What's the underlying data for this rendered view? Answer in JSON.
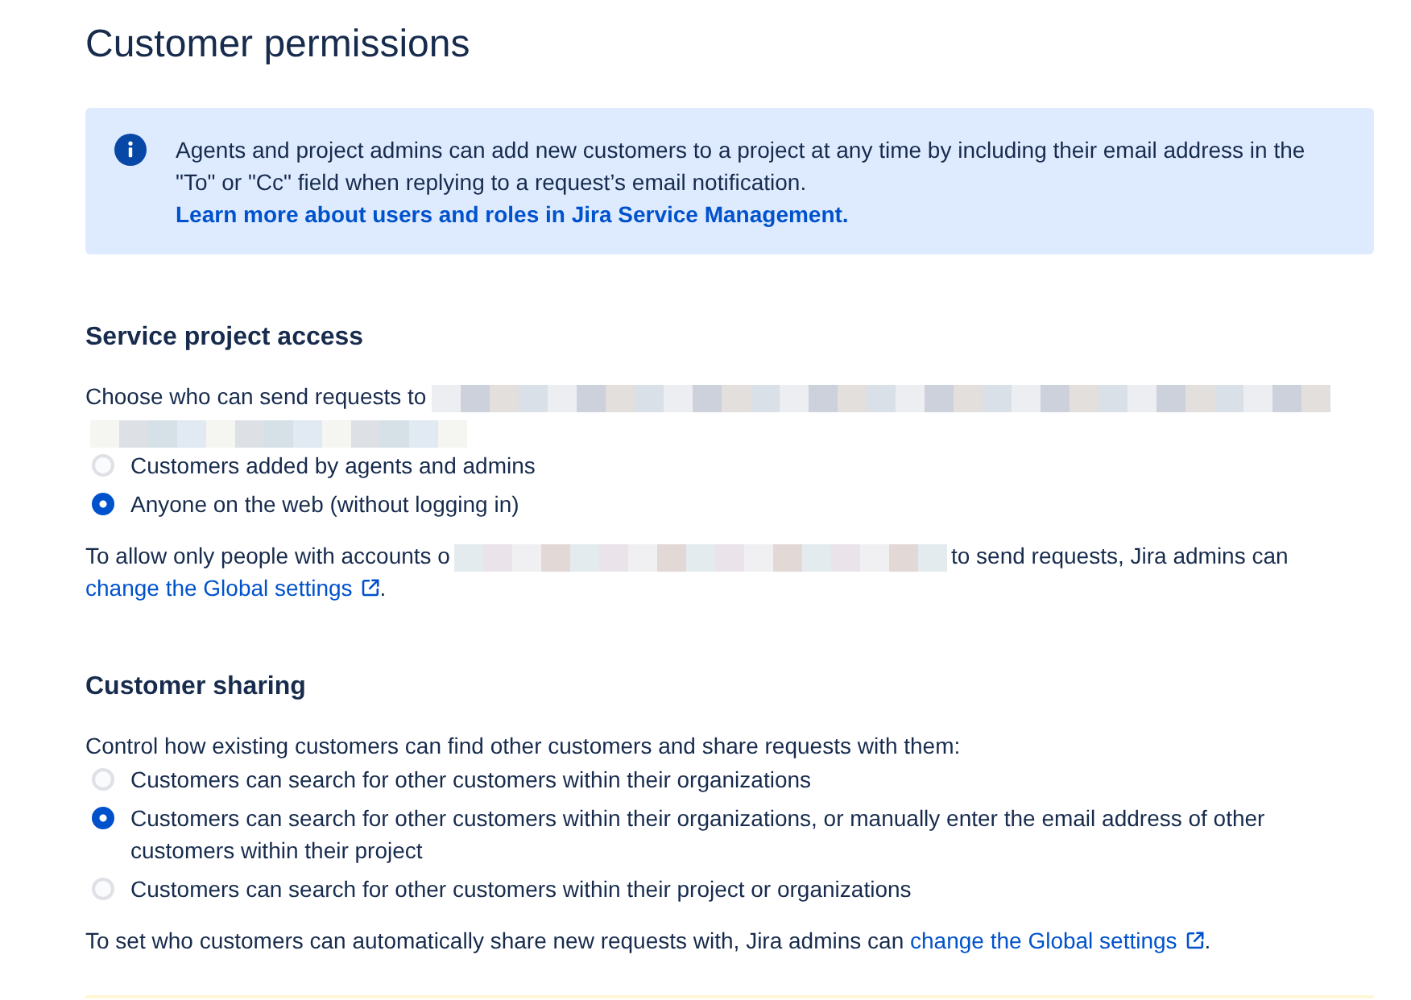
{
  "page_title": "Customer permissions",
  "info_banner": {
    "text": "Agents and project admins can add new customers to a project at any time by including their email address in the \"To\" or \"Cc\" field when replying to a request’s email notification.",
    "link": "Learn more about users and roles in Jira Service Management."
  },
  "sections": [
    {
      "heading": "Service project access",
      "intro": [
        {
          "kind": "text",
          "text": "Choose who can send requests to"
        },
        {
          "kind": "redacted"
        },
        {
          "kind": "redacted"
        }
      ],
      "options": [
        {
          "label": "Customers added by agents and admins",
          "selected": false
        },
        {
          "label": "Anyone on the web (without logging in)",
          "selected": true
        }
      ],
      "note": [
        {
          "kind": "text",
          "text": "To allow only people with accounts o"
        },
        {
          "kind": "redacted"
        },
        {
          "kind": "text",
          "text": "to send requests, Jira admins can"
        },
        {
          "kind": "link",
          "text": "change the Global settings",
          "external": true
        },
        {
          "kind": "text",
          "text": "."
        }
      ]
    },
    {
      "heading": "Customer sharing",
      "intro": [
        {
          "kind": "text",
          "text": "Control how existing customers can find other customers and share requests with them:"
        }
      ],
      "options": [
        {
          "label": "Customers can search for other customers within their organizations",
          "selected": false
        },
        {
          "label": "Customers can search for other customers within their organizations, or manually enter the email address of other customers within their project",
          "selected": true
        },
        {
          "label": "Customers can search for other customers within their project or organizations",
          "selected": false
        }
      ],
      "note": [
        {
          "kind": "text",
          "text": "To set who customers can automatically share new requests with, Jira admins can"
        },
        {
          "kind": "link",
          "text": "change the Global settings",
          "external": true
        },
        {
          "kind": "text",
          "text": "."
        }
      ]
    }
  ]
}
